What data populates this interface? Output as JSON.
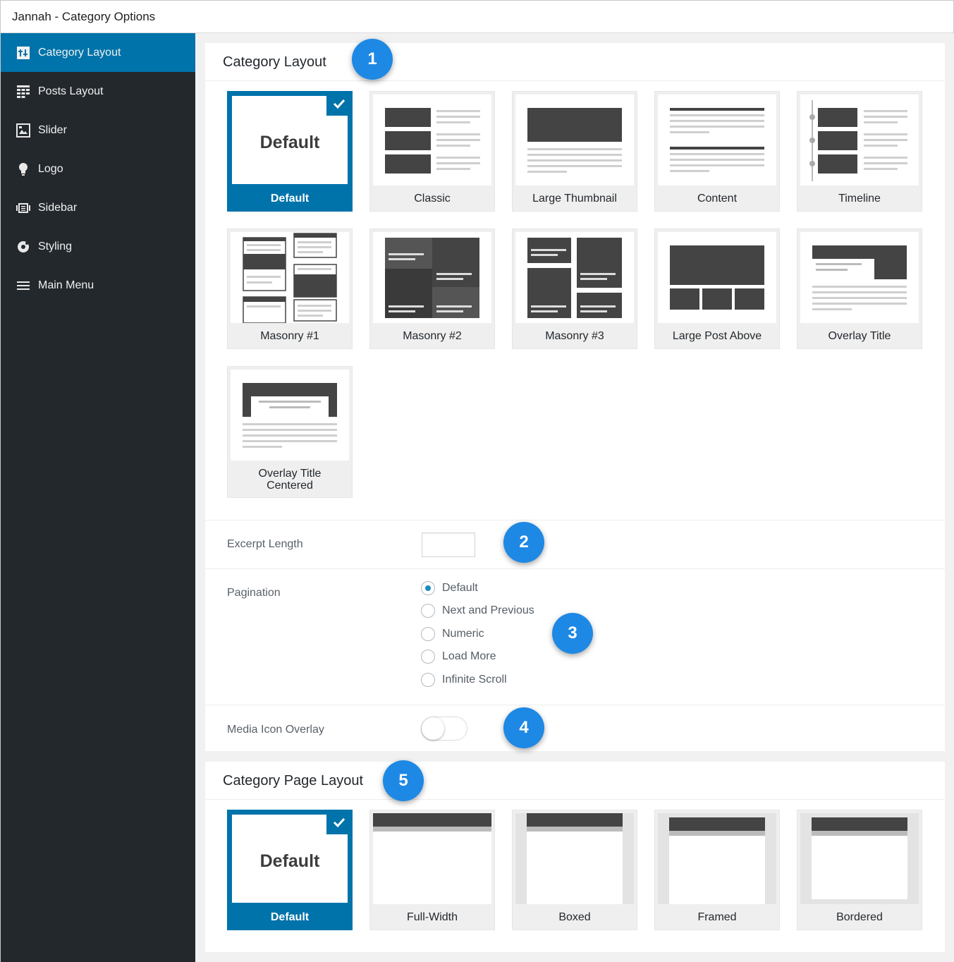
{
  "window": {
    "title": "Jannah - Category Options"
  },
  "sidebar": {
    "items": [
      {
        "label": "Category Layout",
        "icon": "layout-icon",
        "active": true
      },
      {
        "label": "Posts Layout",
        "icon": "grid-icon"
      },
      {
        "label": "Slider",
        "icon": "gallery-icon"
      },
      {
        "label": "Logo",
        "icon": "lightbulb-icon"
      },
      {
        "label": "Sidebar",
        "icon": "sidebar-icon"
      },
      {
        "label": "Styling",
        "icon": "palette-icon"
      },
      {
        "label": "Main Menu",
        "icon": "menu-icon"
      }
    ]
  },
  "category_layout": {
    "title": "Category Layout",
    "badge": "1",
    "selected": "Default",
    "options": [
      {
        "label": "Default",
        "icon": "default-text-thumb"
      },
      {
        "label": "Classic",
        "icon": "classic-layout-thumb"
      },
      {
        "label": "Large Thumbnail",
        "icon": "large-thumbnail-layout-thumb"
      },
      {
        "label": "Content",
        "icon": "content-layout-thumb"
      },
      {
        "label": "Timeline",
        "icon": "timeline-layout-thumb"
      },
      {
        "label": "Masonry #1",
        "icon": "masonry-1-layout-thumb"
      },
      {
        "label": "Masonry #2",
        "icon": "masonry-2-layout-thumb"
      },
      {
        "label": "Masonry #3",
        "icon": "masonry-3-layout-thumb"
      },
      {
        "label": "Large Post Above",
        "icon": "large-post-above-layout-thumb"
      },
      {
        "label": "Overlay Title",
        "icon": "overlay-title-layout-thumb"
      },
      {
        "label": "Overlay Title Centered",
        "line1": "Overlay Title",
        "line2": "Centered",
        "icon": "overlay-title-centered-layout-thumb"
      }
    ],
    "default_thumb_text": "Default"
  },
  "excerpt": {
    "label": "Excerpt Length",
    "value": "",
    "badge": "2"
  },
  "pagination": {
    "label": "Pagination",
    "badge": "3",
    "options": [
      "Default",
      "Next and Previous",
      "Numeric",
      "Load More",
      "Infinite Scroll"
    ],
    "selected": "Default"
  },
  "media_overlay": {
    "label": "Media Icon Overlay",
    "enabled": false,
    "badge": "4"
  },
  "page_layout": {
    "title": "Category Page Layout",
    "badge": "5",
    "selected": "Default",
    "options": [
      {
        "label": "Default",
        "icon": "default-text-thumb"
      },
      {
        "label": "Full-Width",
        "icon": "full-width-layout-thumb"
      },
      {
        "label": "Boxed",
        "icon": "boxed-layout-thumb"
      },
      {
        "label": "Framed",
        "icon": "framed-layout-thumb"
      },
      {
        "label": "Bordered",
        "icon": "bordered-layout-thumb"
      }
    ],
    "default_thumb_text": "Default"
  },
  "colors": {
    "accent": "#0073aa",
    "sidebar_bg": "#23282d",
    "badge": "#1e88e5",
    "thumb_dark": "#444444",
    "thumb_line": "#cfcfcf"
  }
}
